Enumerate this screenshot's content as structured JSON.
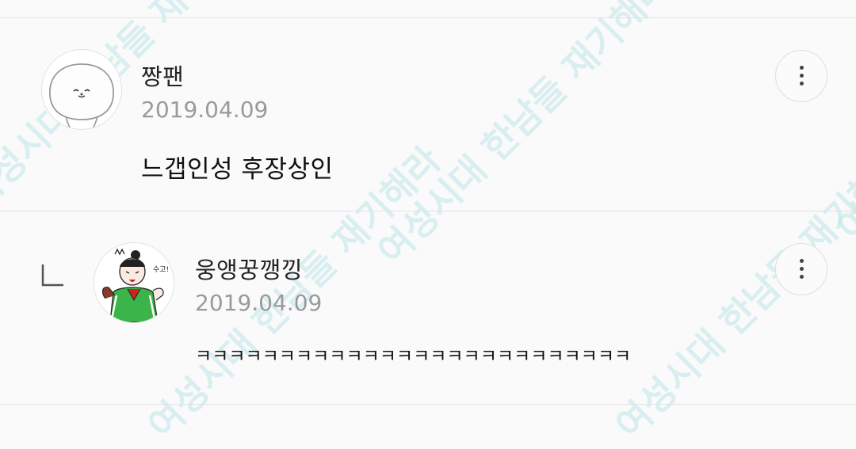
{
  "watermark": {
    "text": "여성시대 한남들 재기해라"
  },
  "comments": [
    {
      "username": "짱팬",
      "date": "2019.04.09",
      "text": "느갭인성 후장상인"
    },
    {
      "username": "웅앵꿍깽낑",
      "date": "2019.04.09",
      "text": "ㅋㅋㅋㅋㅋㅋㅋㅋㅋㅋㅋㅋㅋㅋㅋㅋㅋㅋㅋㅋㅋㅋㅋㅋㅋㅋ",
      "avatar_badge": "수고!"
    }
  ],
  "icons": {
    "more": "more-vertical-icon",
    "reply": "reply-corner-icon"
  }
}
